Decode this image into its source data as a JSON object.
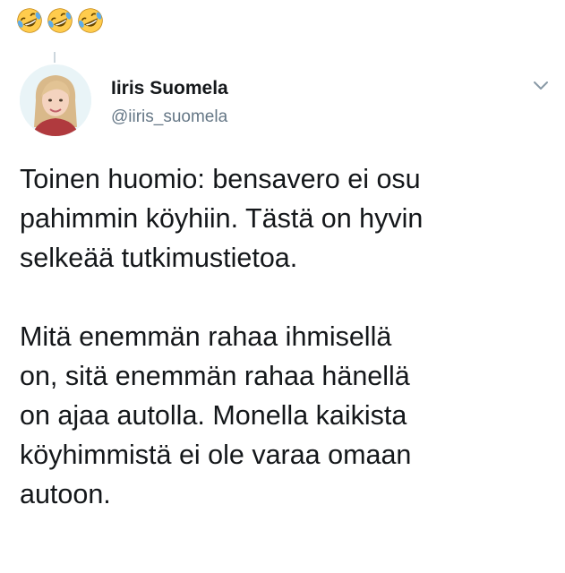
{
  "header": {
    "emojis": [
      "rofl-emoji",
      "rofl-emoji",
      "rofl-emoji"
    ]
  },
  "tweet": {
    "author": {
      "name": "Iiris Suomela",
      "handle": "@iiris_suomela"
    },
    "paragraphs": [
      "Toinen huomio: bensavero ei osu\npahimmin köyhiin. Tästä on hyvin\nselkeää tutkimustietoa.",
      "Mitä enemmän rahaa ihmisellä\non, sitä enemmän rahaa hänellä\non ajaa autolla. Monella kaikista\nköyhimmistä ei ole varaa omaan\nautoon."
    ]
  },
  "colors": {
    "text": "#14171a",
    "secondary": "#657786",
    "emoji_face": "#ffcc4d"
  }
}
